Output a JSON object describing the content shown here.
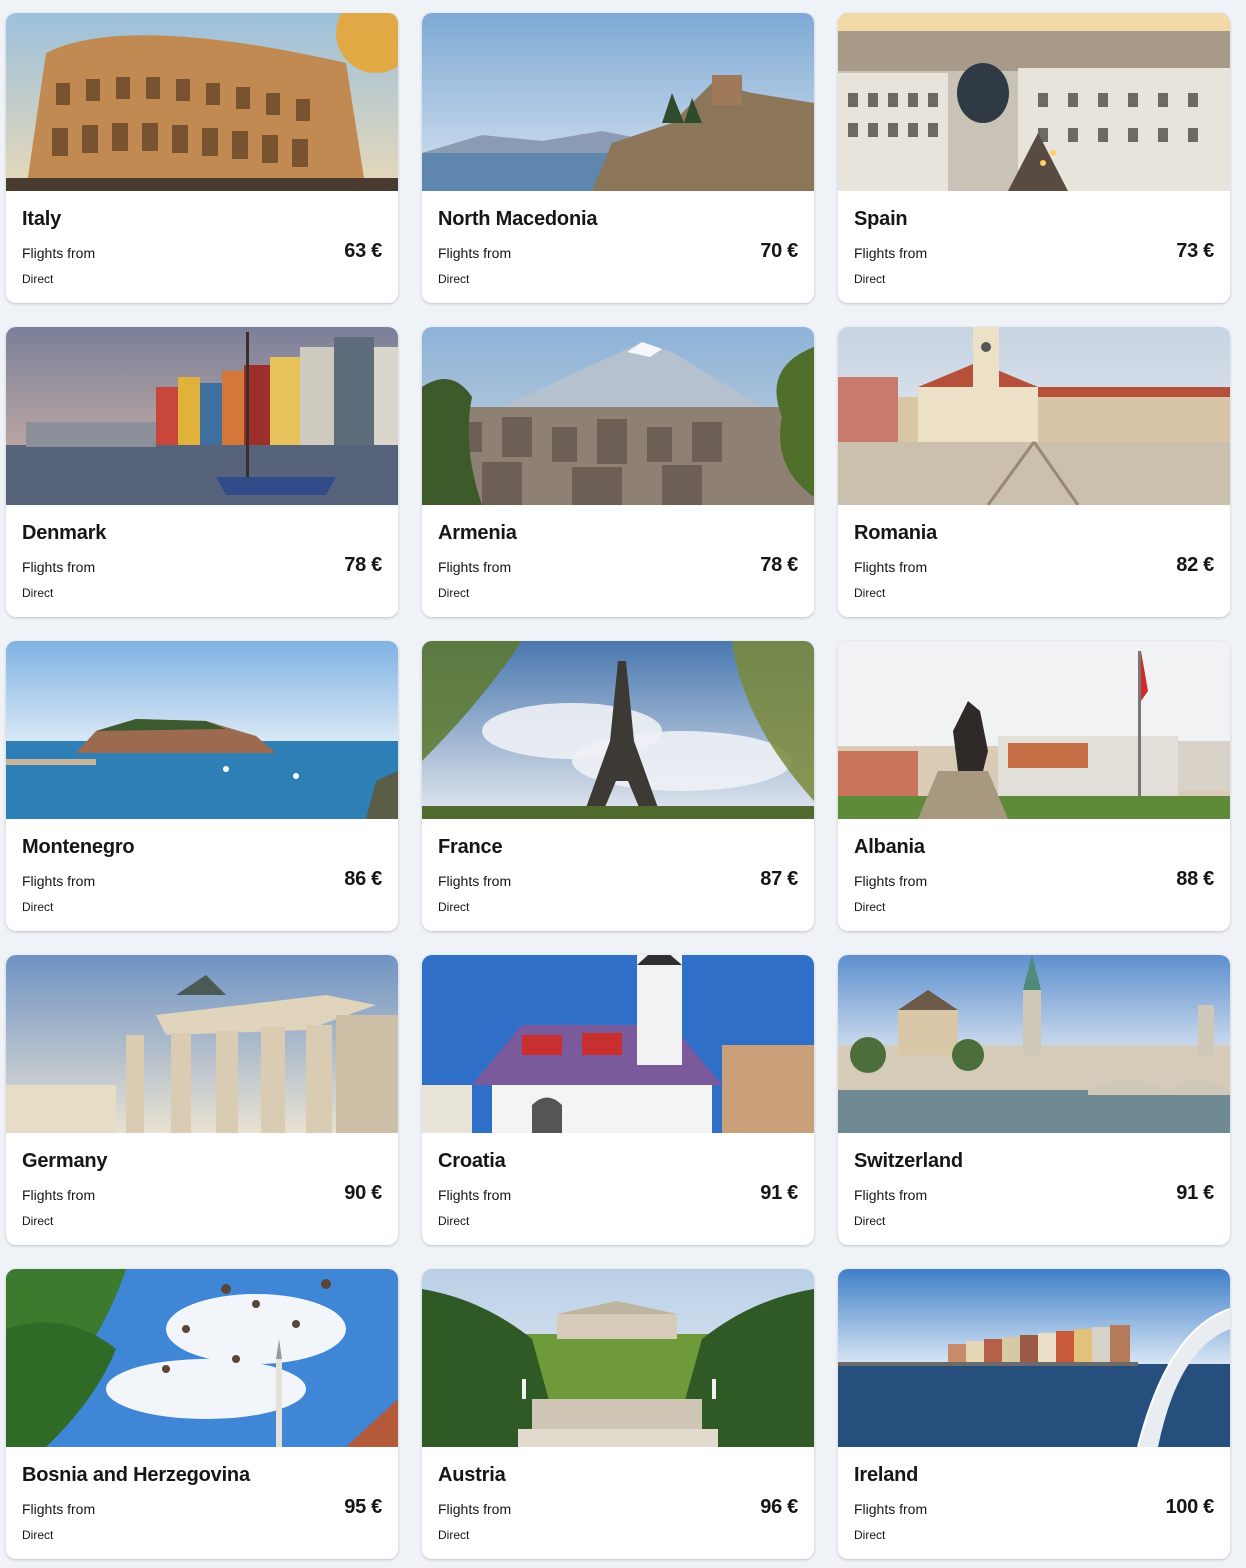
{
  "labels": {
    "flights_from": "Flights from",
    "direct": "Direct"
  },
  "destinations": [
    {
      "name": "Italy",
      "price": "63 €",
      "image": "colosseum"
    },
    {
      "name": "North Macedonia",
      "price": "70 €",
      "image": "lake-church"
    },
    {
      "name": "Spain",
      "price": "73 €",
      "image": "city-skyline"
    },
    {
      "name": "Denmark",
      "price": "78 €",
      "image": "harbor-houses"
    },
    {
      "name": "Armenia",
      "price": "78 €",
      "image": "mountain-city"
    },
    {
      "name": "Romania",
      "price": "82 €",
      "image": "town-square"
    },
    {
      "name": "Montenegro",
      "price": "86 €",
      "image": "island"
    },
    {
      "name": "France",
      "price": "87 €",
      "image": "eiffel-tower"
    },
    {
      "name": "Albania",
      "price": "88 €",
      "image": "equestrian-statue"
    },
    {
      "name": "Germany",
      "price": "90 €",
      "image": "brandenburg-gate"
    },
    {
      "name": "Croatia",
      "price": "91 €",
      "image": "church-tiled-roof"
    },
    {
      "name": "Switzerland",
      "price": "91 €",
      "image": "river-old-town"
    },
    {
      "name": "Bosnia and Herzegovina",
      "price": "95 €",
      "image": "pigeons-sky"
    },
    {
      "name": "Austria",
      "price": "96 €",
      "image": "palace-garden"
    },
    {
      "name": "Ireland",
      "price": "100 €",
      "image": "river-bridge"
    }
  ],
  "colors": {
    "background": "#eff3f8",
    "card": "#ffffff",
    "text": "#161616"
  }
}
